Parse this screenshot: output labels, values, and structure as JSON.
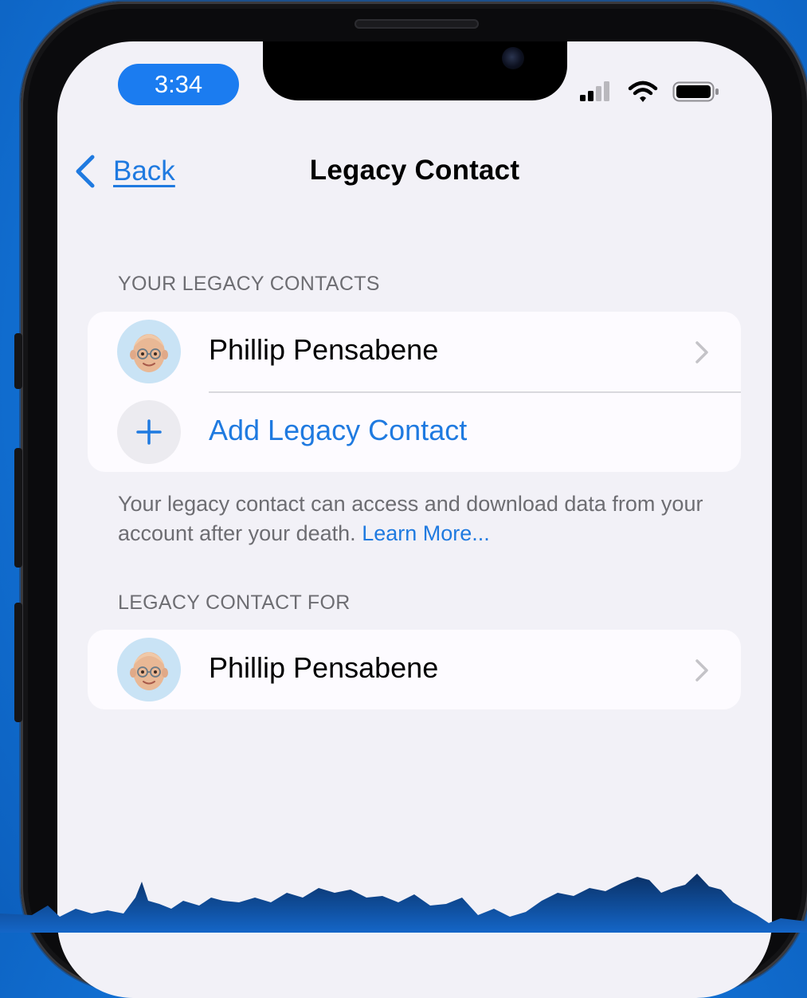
{
  "status_bar": {
    "time": "3:34",
    "icons": [
      "cellular-signal-icon",
      "wifi-icon",
      "battery-icon"
    ]
  },
  "nav": {
    "back_label": "Back",
    "title": "Legacy Contact"
  },
  "your_legacy_contacts": {
    "header": "YOUR LEGACY CONTACTS",
    "contacts": [
      {
        "name": "Phillip Pensabene"
      }
    ],
    "add_label": "Add Legacy Contact",
    "footer": "Your legacy contact can access and download data from your account after your death.",
    "learn_more": "Learn More..."
  },
  "legacy_contact_for": {
    "header": "LEGACY CONTACT FOR",
    "contacts": [
      {
        "name": "Phillip Pensabene"
      }
    ]
  },
  "colors": {
    "accent": "#1f7ae0",
    "time_pill": "#1b7cf0",
    "background": "#1272d6",
    "screen": "#f2f1f7",
    "secondary_text": "#6d6d72"
  }
}
